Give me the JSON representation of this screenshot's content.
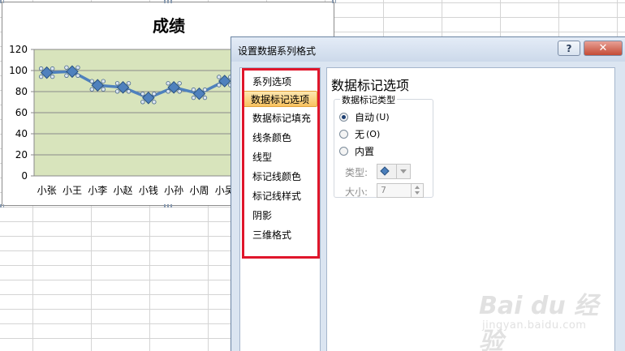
{
  "chart": {
    "title": "成绩"
  },
  "chart_data": {
    "type": "line",
    "title": "成绩",
    "categories": [
      "小张",
      "小王",
      "小李",
      "小赵",
      "小钱",
      "小孙",
      "小周",
      "小吴"
    ],
    "series": [
      {
        "values": [
          98,
          99,
          86,
          84,
          74,
          84,
          78,
          90
        ]
      }
    ],
    "y_ticks": [
      "0",
      "20",
      "40",
      "60",
      "80",
      "100",
      "120"
    ],
    "ylim": [
      0,
      120
    ],
    "grid": true,
    "colors": {
      "plot_area": "#d8e4bc",
      "line": "#4f81bd",
      "marker_fill": "#dbe5f1"
    }
  },
  "dialog": {
    "title": "设置数据系列格式",
    "help_label": "?",
    "close_label": "✕",
    "nav_items": [
      {
        "label": "系列选项",
        "selected": false
      },
      {
        "label": "数据标记选项",
        "selected": true
      },
      {
        "label": "数据标记填充",
        "selected": false
      },
      {
        "label": "线条颜色",
        "selected": false
      },
      {
        "label": "线型",
        "selected": false
      },
      {
        "label": "标记线颜色",
        "selected": false
      },
      {
        "label": "标记线样式",
        "selected": false
      },
      {
        "label": "阴影",
        "selected": false
      },
      {
        "label": "三维格式",
        "selected": false
      }
    ],
    "section_title": "数据标记选项",
    "group_label": "数据标记类型",
    "radios": [
      {
        "label": "自动",
        "shortcut": "(U)",
        "checked": true
      },
      {
        "label": "无",
        "shortcut": "(O)",
        "checked": false
      },
      {
        "label": "内置",
        "shortcut": "",
        "checked": false
      }
    ],
    "type_label": "类型:",
    "size_label": "大小:",
    "size_value": "7",
    "marker_icon": "diamond-icon"
  },
  "watermark": {
    "logo": "Bai du 经验",
    "url": "jingyan.baidu.com"
  },
  "colors": {
    "highlight_box": "#e0162b",
    "selected_item": "#f8c25f",
    "dialog_bg": "#dbe5f1"
  }
}
